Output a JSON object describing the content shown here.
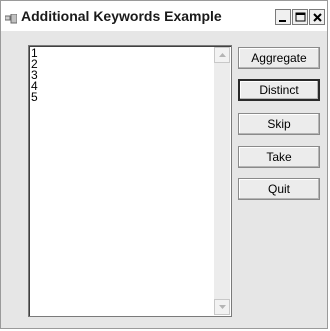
{
  "window": {
    "title": "Additional Keywords Example",
    "controls": {
      "minimize": "minimize-icon",
      "maximize": "maximize-icon",
      "close": "close-icon"
    }
  },
  "listbox": {
    "items": [
      "1",
      "2",
      "3",
      "4",
      "5"
    ]
  },
  "buttons": {
    "aggregate": "Aggregate",
    "distinct": "Distinct",
    "skip": "Skip",
    "take": "Take",
    "quit": "Quit"
  }
}
